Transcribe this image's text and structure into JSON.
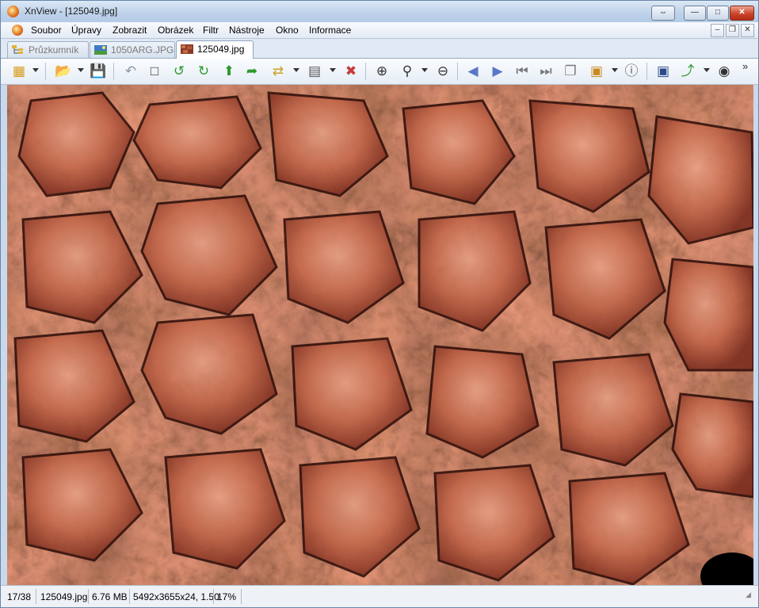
{
  "window": {
    "title": "XnView - [125049.jpg]"
  },
  "menu": {
    "items": [
      "Soubor",
      "Úpravy",
      "Zobrazit",
      "Obrázek",
      "Filtr",
      "Nástroje",
      "Okno",
      "Informace"
    ]
  },
  "tabs": [
    {
      "label": "Průzkumník",
      "active": false
    },
    {
      "label": "1050ARG.JPG",
      "active": false
    },
    {
      "label": "125049.jpg",
      "active": true
    }
  ],
  "toolbar": {
    "icons": [
      "browser-tree-icon",
      "folder-open-icon",
      "save-icon",
      "undo-icon",
      "crop-icon",
      "rotate-left-icon",
      "rotate-right-icon",
      "export-icon",
      "move-icon",
      "convert-icon",
      "adjust-colors-icon",
      "delete-icon",
      "zoom-in-icon",
      "zoom-dropdown-icon",
      "zoom-out-icon",
      "previous-icon",
      "next-icon",
      "first-icon",
      "last-icon",
      "copy-icon",
      "slideshow-icon",
      "info-icon",
      "fullscreen-icon",
      "open-with-icon",
      "binoculars-icon"
    ]
  },
  "status": {
    "position": "17/38",
    "filename": "125049.jpg",
    "filesize": "6.76 MB",
    "dimensions": "5492x3655x24, 1.50",
    "zoom": "17%"
  }
}
